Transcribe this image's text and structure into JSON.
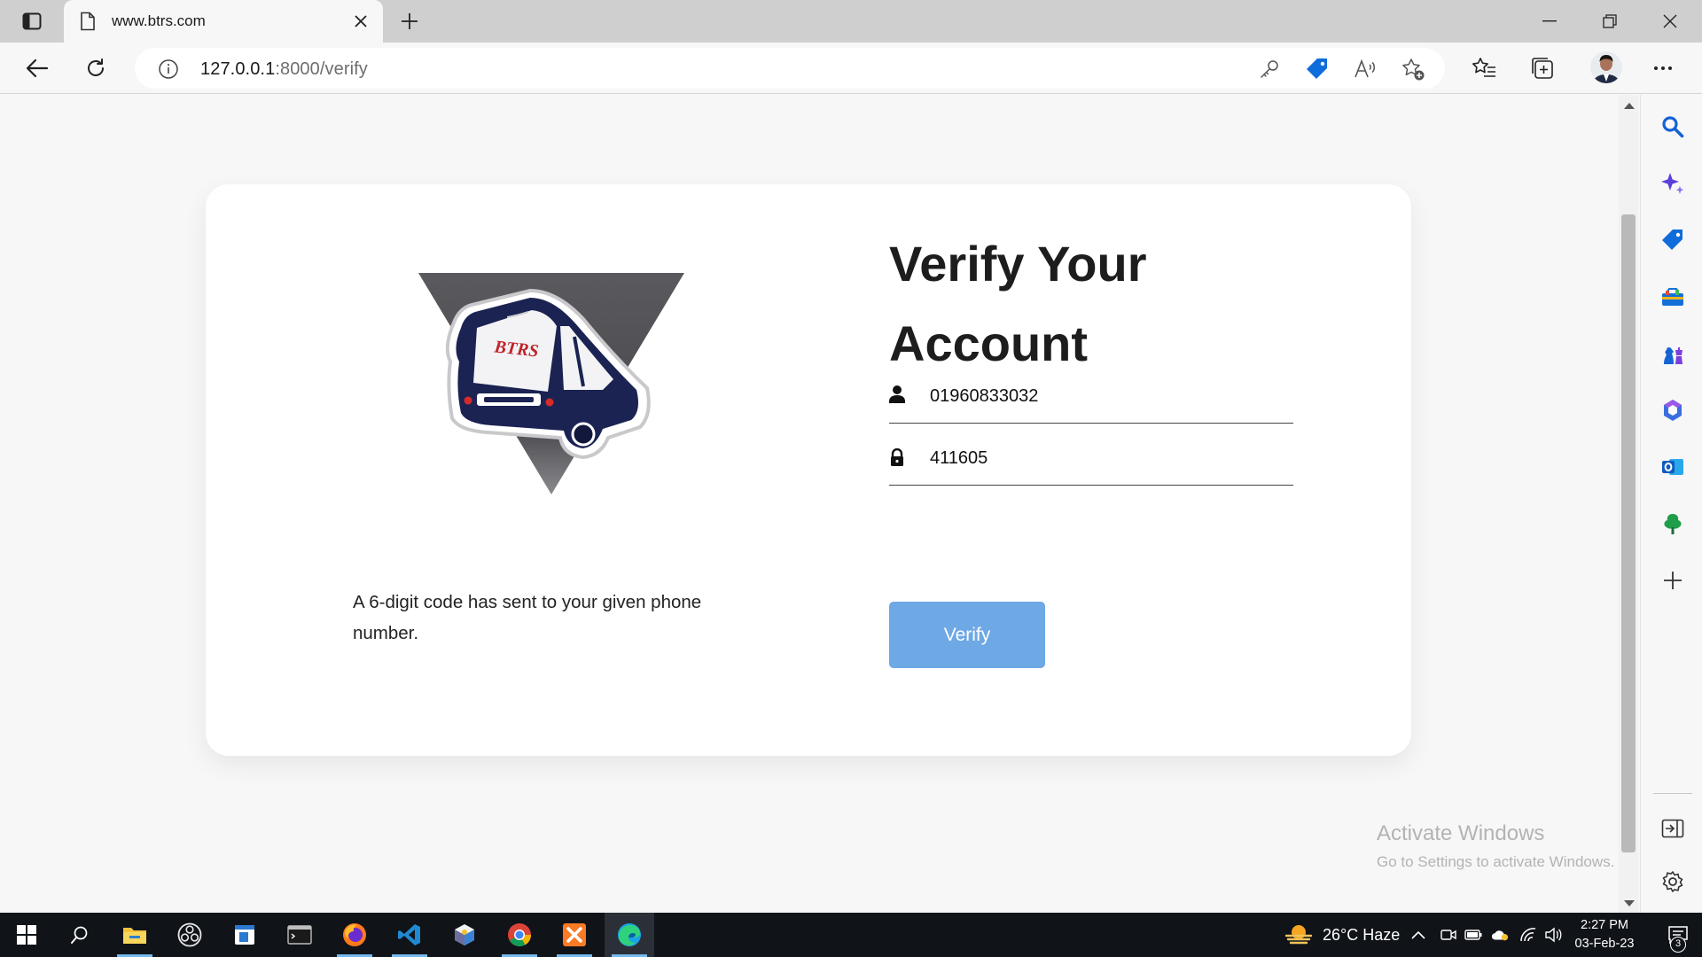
{
  "browser": {
    "tab": {
      "title": "www.btrs.com",
      "icon": "page-icon"
    },
    "url": {
      "host": "127.0.0.1",
      "path": ":8000/verify"
    },
    "window_controls": [
      "minimize-icon",
      "restore-icon",
      "close-icon"
    ]
  },
  "page": {
    "logo": {
      "text": "BTRS",
      "icon": "bus-logo"
    },
    "code_note": "A 6-digit code has sent to your given phone number.",
    "heading": "Verify Your Account",
    "phone": {
      "value": "01960833032",
      "icon": "person-icon"
    },
    "code": {
      "value": "411605",
      "icon": "lock-icon"
    },
    "verify_label": "Verify"
  },
  "watermark": {
    "title": "Activate Windows",
    "subtitle": "Go to Settings to activate Windows."
  },
  "taskbar": {
    "weather": "26°C  Haze",
    "time": "2:27 PM",
    "date": "03-Feb-23",
    "notifications": "3"
  },
  "colors": {
    "accent_button": "#6ea8e5",
    "bus_navy": "#1b2352",
    "logo_triangle": "#58585c",
    "taskbar": "#101318"
  }
}
